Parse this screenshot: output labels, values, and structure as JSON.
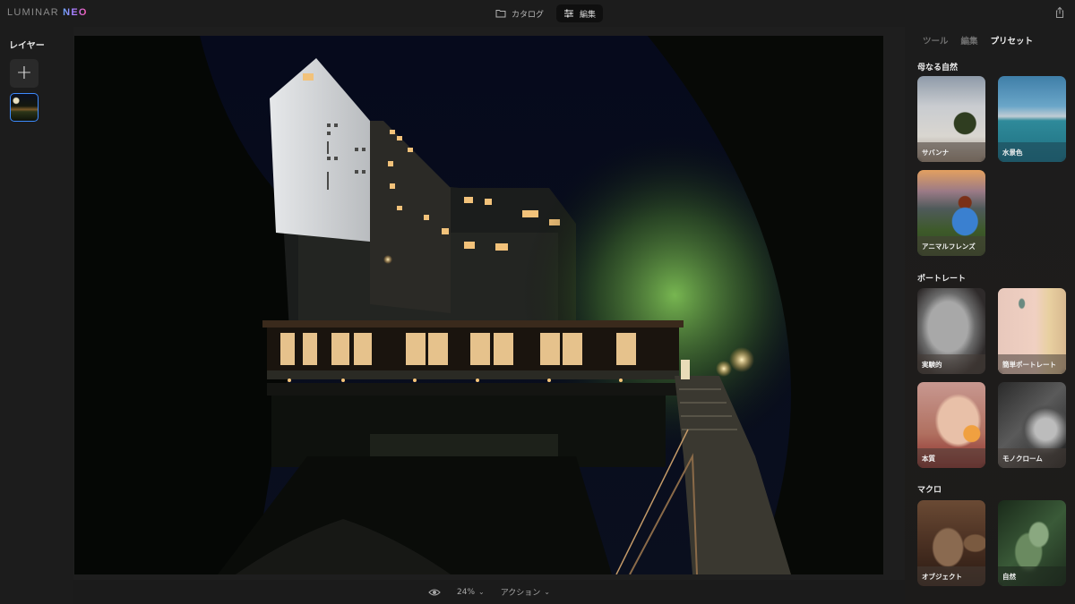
{
  "app": {
    "logo_primary": "LUMINAR",
    "logo_accent": "NEO"
  },
  "topbar": {
    "modes": [
      {
        "icon": "folder-icon",
        "label": "カタログ",
        "active": false
      },
      {
        "icon": "sliders-icon",
        "label": "編集",
        "active": true
      }
    ],
    "share_icon": "share-icon"
  },
  "layers": {
    "title": "レイヤー",
    "add_icon": "plus-icon",
    "items": [
      {
        "name": "photo-layer",
        "selected": true
      }
    ]
  },
  "canvas": {
    "image_description": "Night photo of a lit hotel building with a covered wooden bridge over a stream, trees and stairway path"
  },
  "bottombar": {
    "preview_icon": "eye-icon",
    "zoom": "24%",
    "actions": "アクション"
  },
  "right_panel": {
    "tabs": [
      {
        "label": "ツール",
        "active": false
      },
      {
        "label": "編集",
        "active": false
      },
      {
        "label": "プリセット",
        "active": true
      }
    ],
    "sections": [
      {
        "title": "母なる自然",
        "presets": [
          {
            "label": "サバンナ"
          },
          {
            "label": "水景色"
          },
          {
            "label": "アニマルフレンズ"
          }
        ]
      },
      {
        "title": "ポートレート",
        "presets": [
          {
            "label": "実験的"
          },
          {
            "label": "簡単ポートレート"
          },
          {
            "label": "本質"
          },
          {
            "label": "モノクローム"
          }
        ]
      },
      {
        "title": "マクロ",
        "presets": [
          {
            "label": "オブジェクト"
          },
          {
            "label": "自然"
          }
        ]
      }
    ]
  }
}
